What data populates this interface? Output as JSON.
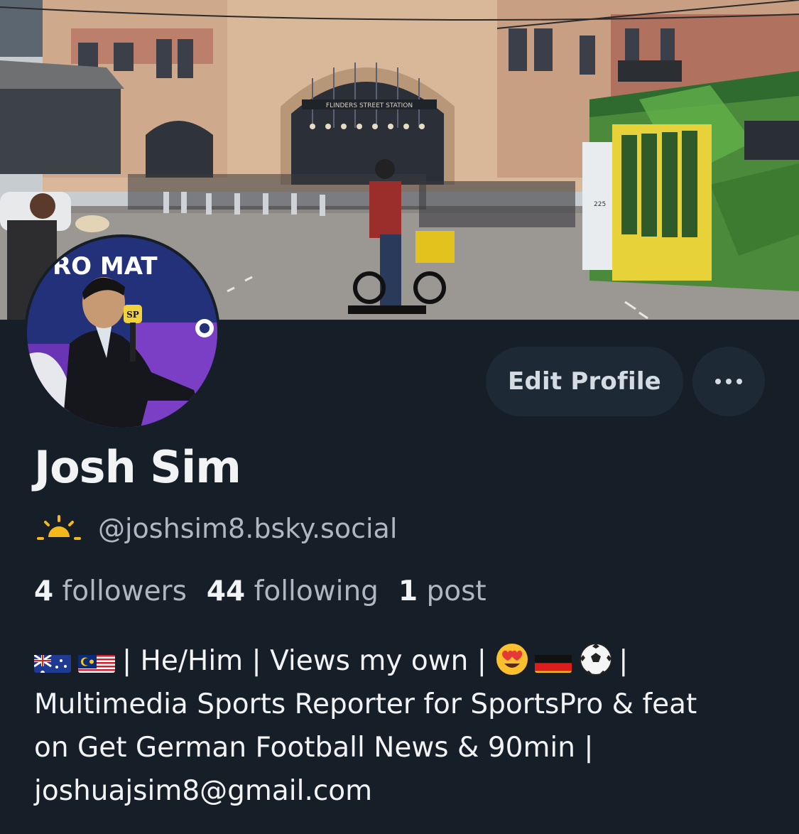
{
  "profile": {
    "display_name": "Josh Sim",
    "handle": "@joshsim8.bsky.social",
    "handle_icon": "sunrise-icon",
    "accent_color": "#f5b81c"
  },
  "actions": {
    "edit_profile_label": "Edit Profile",
    "more_icon": "ellipsis-icon"
  },
  "stats": {
    "followers": {
      "count": "4",
      "label": "followers"
    },
    "following": {
      "count": "44",
      "label": "following"
    },
    "posts": {
      "count": "1",
      "label": "post"
    }
  },
  "bio": {
    "segment_1": "| He/Him | Views my own |",
    "segment_2": "|",
    "line_2": "Multimedia Sports Reporter for SportsPro & feat",
    "line_3": "on Get German Football News & 90min |",
    "line_4": "joshuajsim8@gmail.com",
    "emoji_1": "australia-flag-icon",
    "emoji_2": "malaysia-flag-icon",
    "emoji_3": "heart-eyes-icon",
    "emoji_4": "germany-flag-icon",
    "emoji_5": "soccer-ball-icon"
  },
  "banner": {
    "station_sign": "FLINDERS STREET STATION",
    "tram_number": "225"
  },
  "avatar": {
    "backdrop_text": "RO MAT",
    "mic_logo": "SP"
  }
}
